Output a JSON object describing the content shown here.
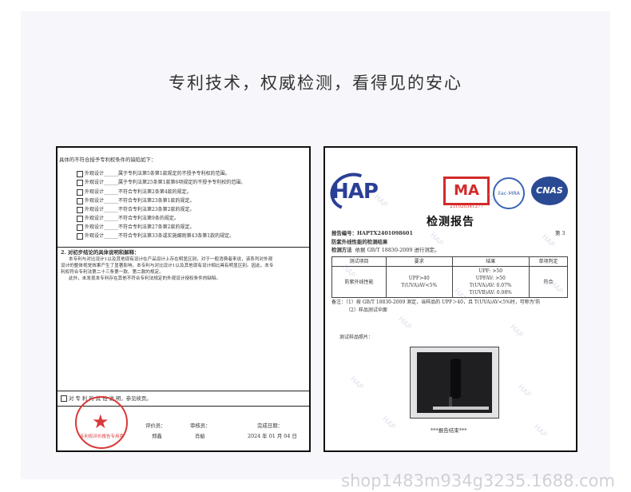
{
  "headline": "专利技术，权威检测，看得见的安心",
  "left_doc": {
    "intro": "具体的不符合授予专利权条件的缺陷如下：",
    "items": [
      {
        "type": "外观设计",
        "text": "属于专利法第5条第1款规定的不授予专利权的范围。"
      },
      {
        "type": "外观设计",
        "text": "属于专利法第25条第1款第6项规定的不授予专利权的范围。"
      },
      {
        "type": "外观设计",
        "text": "不符合专利法第2条第4款的规定。"
      },
      {
        "type": "外观设计",
        "text": "不符合专利法第23条第1款的规定。"
      },
      {
        "type": "外观设计",
        "text": "不符合专利法第23条第2款的规定。"
      },
      {
        "type": "外观设计",
        "text": "不符合专利法第9条的规定。"
      },
      {
        "type": "外观设计",
        "text": "不符合专利法第27条第2款的规定。"
      },
      {
        "type": "外观设计",
        "text": "不符合专利法第33条或实施细则第43条第1款的规定。"
      }
    ],
    "section2_title": "2. 对初步结论的具体说明和解释：",
    "section2_lines": [
      "本专利与对比设计1以及其他现有设计在产品设计上存在明显区别，对于一般消费者来说，该系列对外观",
      "设计的整体视觉效果产生了显著影响，本专利与对比设计1以及其他现有设计相比具有明显区别。因此，本专",
      "利权符合专利法第二十三条第一款、第二款的规定。",
      "此外，未发现本专利存在其他不符合专利法规定的外观设计授权条件的缺陷。"
    ],
    "footer_note": "对 专 利 的 其 他 说 明，参见续页。",
    "evaluator_label": "评价员：",
    "evaluator_name": "郑鑫",
    "reviewer_label": "审核员：",
    "reviewer_name": "肖蛤",
    "date_label": "完成日期：",
    "date_value": "2024 年 01 月 04 日",
    "seal_text": "专利权评价报告专用章"
  },
  "right_doc": {
    "hap_logo": "HAP",
    "ma_logo": "MA",
    "ma_number": "231020341277",
    "ilac_logo": "ilac-MRA",
    "cnas_logo": "CNAS",
    "title": "检测报告",
    "report_no_label": "报告编号：",
    "report_no": "HAPTX2401098601",
    "page_label": "第 3",
    "section_title": "防紫外线性能的检测结果",
    "method_label": "检测方法",
    "method_text": "依据 GB/T 18830-2009 进行测定。",
    "table_headers": [
      "测试项目",
      "要求",
      "结果",
      "单项判定"
    ],
    "table_item": "防紫外线性能",
    "table_req": [
      "UPF>40",
      "T(UVA)AV<5%"
    ],
    "table_results": [
      "UPF: >50",
      "UPFAV: >50",
      "T(UVA)AV: 0.07%",
      "T(UVB)AV: 0.08%"
    ],
    "table_verdict": "符合",
    "remark_label": "备注：",
    "remark_1": "（1）按 GB/T 18830-2009 测定，当样品的 UPF＞40，且 T(UVA)AV<5%时，可称为'防",
    "remark_2": "（2）样品测试伞面",
    "photo_label": "测试样品照片：",
    "end_text": "***报告结束***",
    "watermark": "HAP"
  },
  "site_watermark": "shop1483m934g3235.1688.com"
}
